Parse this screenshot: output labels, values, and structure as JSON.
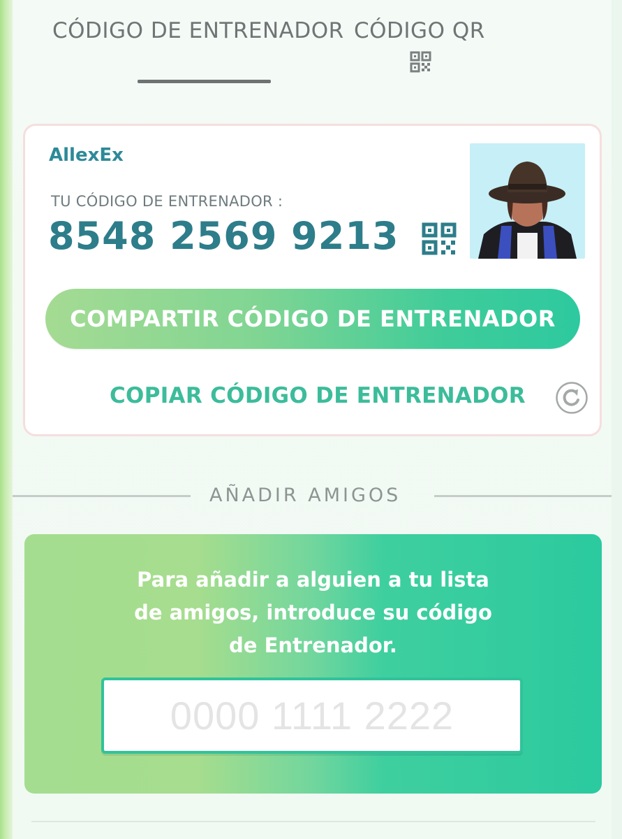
{
  "tabs": [
    {
      "label": "CÓDIGO DE ENTRENADOR",
      "active": true
    },
    {
      "label": "CÓDIGO QR",
      "active": false
    }
  ],
  "trainer": {
    "name": "AllexEx",
    "code_label": "TU CÓDIGO DE ENTRENADOR :",
    "code": "8548 2569 9213"
  },
  "actions": {
    "share_label": "COMPARTIR CÓDIGO DE ENTRENADOR",
    "copy_label": "COPIAR CÓDIGO DE ENTRENADOR"
  },
  "add_friends": {
    "title": "AÑADIR AMIGOS",
    "instructions": [
      "Para añadir a alguien a tu lista",
      "de amigos, introduce su código",
      "de Entrenador."
    ],
    "input_placeholder": "0000 1111 2222",
    "input_value": ""
  },
  "icons": [
    "qr-code-icon",
    "refresh-icon",
    "avatar"
  ],
  "colors": {
    "accent_teal": "#2d7d8a",
    "button_green": "#2dc99f",
    "link_green": "#3cbc9a"
  }
}
